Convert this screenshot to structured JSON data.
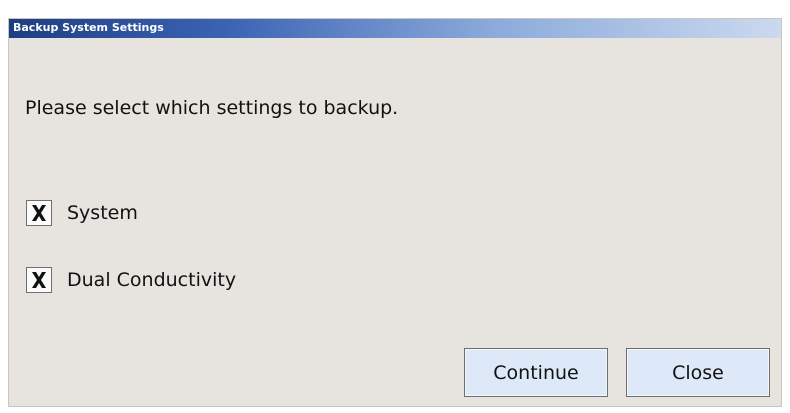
{
  "window": {
    "title": "Backup System Settings"
  },
  "prompt": "Please select which settings to backup.",
  "options": [
    {
      "label": "System",
      "checked": true
    },
    {
      "label": "Dual Conductivity",
      "checked": true
    }
  ],
  "buttons": {
    "continue_label": "Continue",
    "close_label": "Close"
  },
  "icons": {
    "checkbox_mark": "x-mark-icon"
  },
  "colors": {
    "title_bar_start": "#1e3e82",
    "title_bar_end": "#ccd9ef",
    "dialog_background": "#e7e4df",
    "button_background": "#dde9f8"
  }
}
